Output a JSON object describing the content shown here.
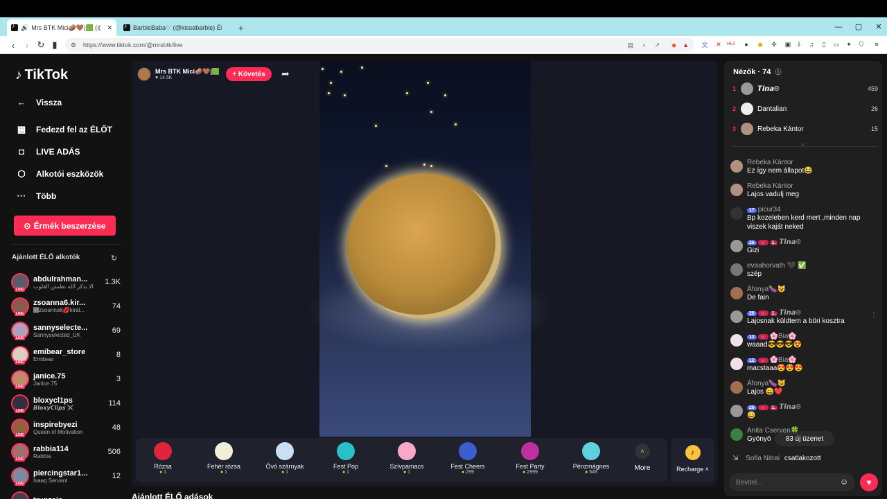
{
  "browser": {
    "tabs": [
      {
        "label": "Mrs BTK Mici🥔🤎|🟩 (@m"
      },
      {
        "label": "BarbieBaba♡ (@kissabarbie) ÉLŐ az"
      }
    ],
    "new_tab": "+",
    "url": "https://www.tiktok.com/@mrsbtk/live",
    "ext_hls": "HLS"
  },
  "sidebar": {
    "logo": "TikTok",
    "back": "Vissza",
    "nav": [
      {
        "label": "Fedezd fel az ÉLŐT",
        "icon": "calendar-icon"
      },
      {
        "label": "LIVE ADÁS",
        "icon": "camera-icon"
      },
      {
        "label": "Alkotói eszközök",
        "icon": "tools-icon"
      },
      {
        "label": "Több",
        "icon": "more-icon"
      }
    ],
    "coins_button": "Érmék beszerzése",
    "recommended_title": "Ajánlott ÉLŐ alkotók",
    "live_tag": "LIVE",
    "creators": [
      {
        "name": "abdulrahman...",
        "sub": "الا بذكر الله تطمئن القلوب",
        "count": "1.3K",
        "color": "#5a5a6a"
      },
      {
        "name": "zsoanna6.kir...",
        "sub": "🏾zsoanna6💋királ...",
        "count": "74",
        "color": "#8a5a4a"
      },
      {
        "name": "sannyselecte...",
        "sub": "Sannyselected_UK",
        "count": "69",
        "color": "#b0a0c0"
      },
      {
        "name": "emibear_store",
        "sub": "Emibear",
        "count": "8",
        "color": "#d8cfc0"
      },
      {
        "name": "janice.75",
        "sub": "Janice.75",
        "count": "3",
        "color": "#c08a6a"
      },
      {
        "name": "bloxycl1ps",
        "sub": "𝘽𝙡𝙤𝙭𝙮𝘾𝙡𝙞𝙥𝙨 ⚔️",
        "count": "114",
        "color": "#303040"
      },
      {
        "name": "inspirebyezi",
        "sub": "Queen of Motivation",
        "count": "48",
        "color": "#906040"
      },
      {
        "name": "rabbia114",
        "sub": "Rabbia",
        "count": "506",
        "color": "#a07070"
      },
      {
        "name": "piercingstar1...",
        "sub": "Isaaq Servant",
        "count": "12",
        "color": "#7a8aa0"
      },
      {
        "name": "trunzaio",
        "sub": "",
        "count": "",
        "color": "#404050"
      }
    ]
  },
  "stream": {
    "host_name": "Mrs BTK Mici🥔🤎|🟩",
    "host_likes": "♥ 14.5K",
    "follow": "+ Követés",
    "below_title": "Ajánlott ÉLŐ adások"
  },
  "gifts": [
    {
      "name": "Rózsa",
      "price": "1",
      "color": "#e0243c"
    },
    {
      "name": "Fehér rózsa",
      "price": "1",
      "color": "#f2efd8"
    },
    {
      "name": "Óvó szárnyak",
      "price": "1",
      "color": "#c9dff5"
    },
    {
      "name": "Fest Pop",
      "price": "1",
      "color": "#28c1c8"
    },
    {
      "name": "Szívpamacs",
      "price": "1",
      "color": "#f7a8c8"
    },
    {
      "name": "Fest Cheers",
      "price": "299",
      "color": "#3b5ed0"
    },
    {
      "name": "Fest Party",
      "price": "2999",
      "color": "#c02fa0"
    },
    {
      "name": "Pénzmágnes",
      "price": "549",
      "color": "#5fd0e0"
    }
  ],
  "gift_more": "More",
  "recharge": "Recharge ˄",
  "viewers": {
    "title": "Nézők · 74",
    "list": [
      {
        "rank": "1",
        "name": "𝙏𝙞𝙣𝙖®",
        "score": "459",
        "color": "#999"
      },
      {
        "rank": "2",
        "name": "Dantalian",
        "score": "26",
        "color": "#eee"
      },
      {
        "rank": "3",
        "name": "Rebeka Kántor",
        "score": "15",
        "color": "#b09080"
      }
    ]
  },
  "chat": [
    {
      "user": "Rebeka Kántor",
      "badges": [],
      "text": "Ez így nem állapot😂",
      "color": "#b09080"
    },
    {
      "user": "Rebeka Kántor",
      "badges": [],
      "text": "Lajos vadulj meg",
      "color": "#b09080"
    },
    {
      "user": "picur34",
      "badges": [
        "17"
      ],
      "text": "Bp kozeleben kerd mert ,minden nap viszek kaját neked",
      "color": "#333"
    },
    {
      "user": "𝙏𝙞𝙣𝙖®",
      "badges": [
        "26",
        "💗",
        "1."
      ],
      "text": "Gizi",
      "color": "#999"
    },
    {
      "user": "evaahorvath 🖤 ✅",
      "badges": [],
      "text": "szép",
      "color": "#777"
    },
    {
      "user": "Áfonya🍆😺",
      "badges": [],
      "text": "De fain",
      "color": "#a07050"
    },
    {
      "user": "𝙏𝙞𝙣𝙖®",
      "badges": [
        "26",
        "💗",
        "1."
      ],
      "text": "Lajosnak küldtem a böri kosztra",
      "color": "#999"
    },
    {
      "user": "🌸Bia🌸",
      "badges": [
        "12",
        "💗"
      ],
      "text": "waaad😎😎😎😍",
      "color": "#f0e0e8"
    },
    {
      "user": "🌸Bia🌸",
      "badges": [
        "12",
        "💗"
      ],
      "text": "macstaaa😍😍😍",
      "color": "#f0e0e8"
    },
    {
      "user": "Áfonya🍆😺",
      "badges": [],
      "text": "Lajos 😀❤️",
      "color": "#a07050"
    },
    {
      "user": "𝙏𝙞𝙣𝙖®",
      "badges": [
        "26",
        "💗",
        "1."
      ],
      "text": "😀",
      "color": "#999"
    },
    {
      "user": "Anita Cserven🍀",
      "badges": [],
      "text": "Gyönyö",
      "color": "#3a8040"
    }
  ],
  "new_messages": "83 új üzenet",
  "joined": {
    "user": "Sofia Nitrai",
    "action": "csatlakozott"
  },
  "input_placeholder": "Bevitel..."
}
